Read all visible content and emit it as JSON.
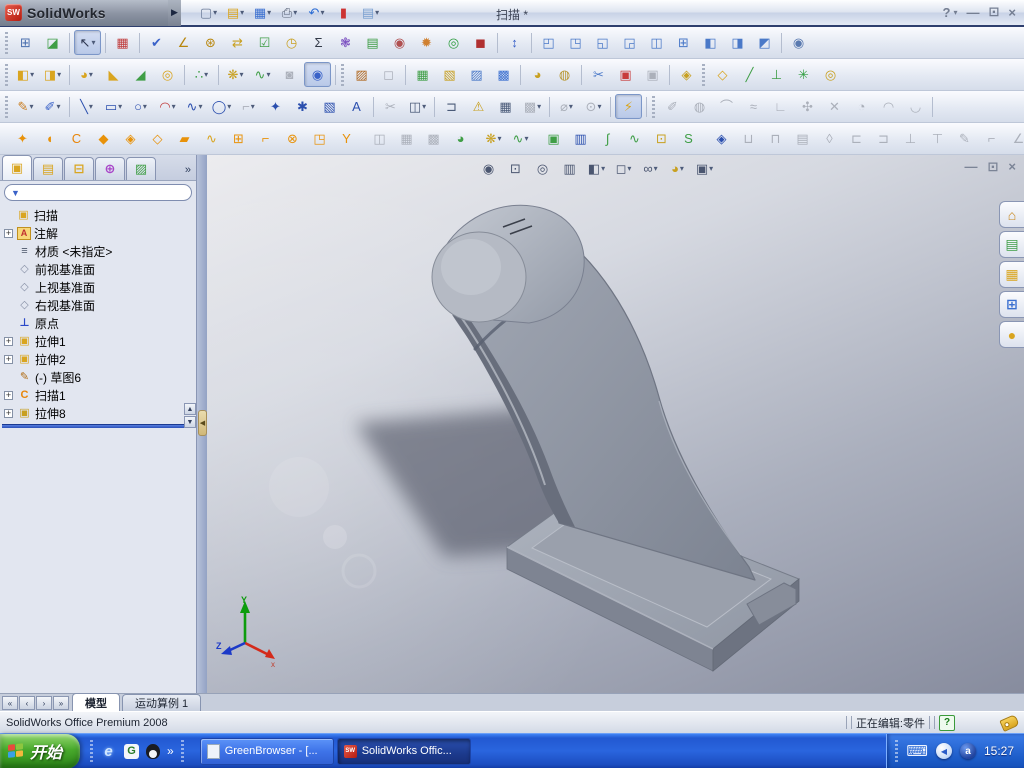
{
  "titlebar": {
    "brand": "SolidWorks",
    "logo": "SW",
    "flyout": "▶",
    "title": "扫描 *",
    "controls": {
      "help": "?",
      "dropdown": "▾",
      "minimize": "—",
      "restore": "⊡",
      "close": "×"
    }
  },
  "toolbars": {
    "standard": [
      {
        "n": "new-document",
        "g": "▢",
        "c": "#6b7b98",
        "d": 1
      },
      {
        "n": "open-document",
        "g": "▤",
        "c": "#d9a520",
        "d": 1
      },
      {
        "n": "save",
        "g": "▦",
        "c": "#3a6fd0",
        "d": 1
      },
      {
        "n": "print",
        "g": "⎙",
        "c": "#5a6478",
        "d": 1
      },
      {
        "n": "undo",
        "g": "↶",
        "c": "#2b6cd4",
        "d": 1
      },
      {
        "n": "performance",
        "g": "▮",
        "c": "#cc3333"
      },
      {
        "n": "options",
        "g": "▤",
        "c": "#7aa0d0",
        "d": 1
      }
    ],
    "row2": [
      {
        "grip": 1
      },
      {
        "n": "document-properties",
        "g": "⊞",
        "c": "#4a6fae"
      },
      {
        "n": "publish-edrawings",
        "g": "◪",
        "c": "#3f9e46"
      },
      {
        "sep": 1
      },
      {
        "n": "select",
        "g": "↖",
        "c": "#2c3650",
        "d": 1,
        "p": 1
      },
      {
        "sep": 1
      },
      {
        "n": "color-swatches",
        "g": "▦",
        "c": "#c03c3c"
      },
      {
        "sep": 1
      },
      {
        "n": "spell-checker",
        "g": "✔",
        "c": "#3a62c8"
      },
      {
        "n": "measure",
        "g": "∠",
        "c": "#b8860b"
      },
      {
        "n": "mass-properties",
        "g": "⊛",
        "c": "#b8860b"
      },
      {
        "n": "move-copy",
        "g": "⇄",
        "c": "#c8a020"
      },
      {
        "n": "design-checker",
        "g": "☑",
        "c": "#3f9e46"
      },
      {
        "n": "feature-statistics",
        "g": "◷",
        "c": "#c8a020"
      },
      {
        "n": "equations",
        "g": "Σ",
        "c": "#333a48"
      },
      {
        "n": "curvature-comb",
        "g": "❃",
        "c": "#7a4fc0"
      },
      {
        "n": "deviation-analysis",
        "g": "▤",
        "c": "#3f9e46"
      },
      {
        "n": "photoworks-preview",
        "g": "◉",
        "c": "#b05050"
      },
      {
        "n": "render-lighting",
        "g": "✹",
        "c": "#d08030"
      },
      {
        "n": "verification",
        "g": "◎",
        "c": "#2f9e3f"
      },
      {
        "n": "simulation",
        "g": "◼",
        "c": "#b03030"
      },
      {
        "sep": 1
      },
      {
        "n": "reference-dimension",
        "g": "↕",
        "c": "#3a62c8"
      },
      {
        "sep": 1
      },
      {
        "n": "view-front",
        "g": "◰",
        "c": "#4a79c8"
      },
      {
        "n": "view-back",
        "g": "◳",
        "c": "#4a79c8"
      },
      {
        "n": "view-left",
        "g": "◱",
        "c": "#4a79c8"
      },
      {
        "n": "view-right",
        "g": "◲",
        "c": "#4a79c8"
      },
      {
        "n": "view-top",
        "g": "◫",
        "c": "#4a79c8"
      },
      {
        "n": "view-bottom",
        "g": "⊞",
        "c": "#4a79c8"
      },
      {
        "n": "view-isometric",
        "g": "◧",
        "c": "#4a79c8"
      },
      {
        "n": "view-trimetric",
        "g": "◨",
        "c": "#4a79c8"
      },
      {
        "n": "view-dimetric",
        "g": "◩",
        "c": "#4a79c8"
      },
      {
        "sep": 1
      },
      {
        "n": "zoom-magnifier",
        "g": "◉",
        "c": "#5a7ab0"
      }
    ],
    "row3": [
      {
        "grip": 1
      },
      {
        "n": "view-orientation",
        "g": "◧",
        "c": "#d9a520",
        "d": 1
      },
      {
        "n": "display-mode",
        "g": "◨",
        "c": "#d9a520",
        "d": 1
      },
      {
        "sep": 1
      },
      {
        "n": "shaded-view",
        "g": "◕",
        "c": "#d9a520",
        "d": 1
      },
      {
        "n": "section-view",
        "g": "◣",
        "c": "#d9a520"
      },
      {
        "n": "section-plane",
        "g": "◢",
        "c": "#3f9e46"
      },
      {
        "n": "camera-view",
        "g": "◎",
        "c": "#d9a520"
      },
      {
        "sep": 1
      },
      {
        "n": "display-states",
        "g": "∴",
        "c": "#3f9e46",
        "d": 1
      },
      {
        "sep": 1
      },
      {
        "n": "quick-snaps",
        "g": "❋",
        "c": "#c8a020",
        "d": 1
      },
      {
        "n": "spline-tools",
        "g": "∿",
        "c": "#3f9e46",
        "d": 1
      },
      {
        "n": "align-tool",
        "g": "◙",
        "c": "#a9aeb8",
        "x": 1
      },
      {
        "n": "instant3d",
        "g": "◉",
        "c": "#3a62c8",
        "p": 1
      },
      {
        "sep": 1
      },
      {
        "grip": 1
      },
      {
        "n": "photoworks-render",
        "g": "▨",
        "c": "#b06820"
      },
      {
        "n": "render-region",
        "g": "◻",
        "c": "#a9aeb8",
        "x": 1
      },
      {
        "sep": 1
      },
      {
        "n": "render-to-file",
        "g": "▦",
        "c": "#3f9e46"
      },
      {
        "n": "render-last",
        "g": "▧",
        "c": "#c8a020"
      },
      {
        "n": "render-select",
        "g": "▨",
        "c": "#4a79c8"
      },
      {
        "n": "render-save",
        "g": "▩",
        "c": "#3a6fd0"
      },
      {
        "sep": 1
      },
      {
        "n": "scene-editor",
        "g": "◕",
        "c": "#c8a020"
      },
      {
        "n": "materials-editor",
        "g": "◍",
        "c": "#b8962e"
      },
      {
        "sep": 1
      },
      {
        "n": "copy-appearance",
        "g": "✂",
        "c": "#4a79c8"
      },
      {
        "n": "apply-appearance",
        "g": "▣",
        "c": "#c83c3c"
      },
      {
        "n": "paste-appearance",
        "g": "▣",
        "c": "#a9aeb8",
        "x": 1
      },
      {
        "sep": 1
      },
      {
        "n": "edit-scene",
        "g": "◈",
        "c": "#c8a020"
      },
      {
        "grip": 1
      },
      {
        "n": "reference-plane",
        "g": "◇",
        "c": "#d9a520"
      },
      {
        "n": "reference-axis",
        "g": "╱",
        "c": "#3f9e46"
      },
      {
        "n": "coordinate-system",
        "g": "⊥",
        "c": "#3f9e46"
      },
      {
        "n": "reference-point",
        "g": "✳",
        "c": "#2f9e3f"
      },
      {
        "n": "mate-reference",
        "g": "◎",
        "c": "#c8a020"
      }
    ],
    "row4": [
      {
        "grip": 1
      },
      {
        "n": "sketch",
        "g": "✎",
        "c": "#c87a1a",
        "d": 1
      },
      {
        "n": "3d-sketch",
        "g": "✐",
        "c": "#3a62c8",
        "d": 1
      },
      {
        "sep": 1
      },
      {
        "n": "line",
        "g": "╲",
        "c": "#2b4fae",
        "d": 1
      },
      {
        "n": "rectangle",
        "g": "▭",
        "c": "#2b4fae",
        "d": 1
      },
      {
        "n": "circle",
        "g": "○",
        "c": "#2b4fae",
        "d": 1
      },
      {
        "n": "arc",
        "g": "◠",
        "c": "#c03c3c",
        "d": 1
      },
      {
        "n": "spline",
        "g": "∿",
        "c": "#2b4fae",
        "d": 1
      },
      {
        "n": "ellipse",
        "g": "◯",
        "c": "#2b4fae",
        "d": 1
      },
      {
        "n": "sketch-fillet",
        "g": "⌐",
        "c": "#a9aeb8",
        "x": 1,
        "d": 1
      },
      {
        "n": "polygon",
        "g": "✦",
        "c": "#2b4fae"
      },
      {
        "n": "point",
        "g": "✱",
        "c": "#2b4fae"
      },
      {
        "n": "select-region",
        "g": "▧",
        "c": "#2b4fae"
      },
      {
        "n": "text",
        "g": "A",
        "c": "#2b4fae"
      },
      {
        "sep": 1
      },
      {
        "n": "trim-entities",
        "g": "✂",
        "c": "#a9aeb8",
        "x": 1
      },
      {
        "n": "convert-entities",
        "g": "◫",
        "c": "#4a5a78",
        "d": 1
      },
      {
        "sep": 1
      },
      {
        "n": "offset-entities",
        "g": "⊐",
        "c": "#4a5a78"
      },
      {
        "n": "sketch-warning",
        "g": "⚠",
        "c": "#c8a020"
      },
      {
        "n": "linear-sketch-pattern",
        "g": "▦",
        "c": "#4a5a78"
      },
      {
        "n": "circular-sketch-pattern",
        "g": "▩",
        "c": "#a9aeb8",
        "x": 1,
        "d": 1
      },
      {
        "sep": 1
      },
      {
        "n": "modify-sketch",
        "g": "⌀",
        "c": "#a9aeb8",
        "x": 1,
        "d": 1
      },
      {
        "n": "smart-dimension",
        "g": "⊙",
        "c": "#a9aeb8",
        "x": 1,
        "d": 1
      },
      {
        "sep": 1
      },
      {
        "n": "add-relations",
        "g": "⚡",
        "c": "#d9a520",
        "p": 1
      },
      {
        "sep": 1
      },
      {
        "grip": 1
      },
      {
        "n": "relation-horizontal",
        "g": "✐",
        "c": "#a9aeb8",
        "x": 1
      },
      {
        "n": "relation-vertical",
        "g": "◍",
        "c": "#a9aeb8",
        "x": 1
      },
      {
        "n": "relation-tangent",
        "g": "⌒",
        "c": "#a9aeb8",
        "x": 1
      },
      {
        "n": "relation-parallel",
        "g": "≈",
        "c": "#a9aeb8",
        "x": 1
      },
      {
        "n": "relation-perpendicular",
        "g": "∟",
        "c": "#a9aeb8",
        "x": 1
      },
      {
        "n": "relation-fix",
        "g": "✣",
        "c": "#a9aeb8",
        "x": 1
      },
      {
        "n": "relation-delete",
        "g": "✕",
        "c": "#a9aeb8",
        "x": 1
      },
      {
        "n": "relation-coincident",
        "g": "◔",
        "c": "#a9aeb8",
        "x": 1
      },
      {
        "n": "relation-concentric",
        "g": "◠",
        "c": "#a9aeb8",
        "x": 1
      },
      {
        "n": "relation-symmetric",
        "g": "◡",
        "c": "#a9aeb8",
        "x": 1
      },
      {
        "sep": 1
      }
    ],
    "row5": [
      {
        "grip": 1
      },
      {
        "n": "swept-boss",
        "g": "✦",
        "c": "#e8920a"
      },
      {
        "n": "revolved-boss",
        "g": "◖",
        "c": "#e8920a"
      },
      {
        "n": "sweep",
        "g": "C",
        "c": "#e8860a"
      },
      {
        "n": "lofted-boss",
        "g": "◆",
        "c": "#e8920a"
      },
      {
        "n": "extruded-boss",
        "g": "◈",
        "c": "#e8920a"
      },
      {
        "n": "extruded-cut",
        "g": "◇",
        "c": "#e8920a"
      },
      {
        "n": "pad",
        "g": "▰",
        "c": "#e8920a"
      },
      {
        "n": "dome",
        "g": "∿",
        "c": "#d9a520"
      },
      {
        "n": "pattern-stack",
        "g": "⊞",
        "c": "#e8920a"
      },
      {
        "n": "bend",
        "g": "⌐",
        "c": "#e8920a"
      },
      {
        "n": "cut-revolve",
        "g": "⊗",
        "c": "#e8920a"
      },
      {
        "n": "wrap",
        "g": "◳",
        "c": "#e8920a"
      },
      {
        "n": "rib",
        "g": "Y",
        "c": "#e8920a"
      },
      {
        "sep": 1
      },
      {
        "n": "mirror-feature",
        "g": "◫",
        "c": "#a9aeb8",
        "x": 1
      },
      {
        "n": "linear-pattern",
        "g": "▦",
        "c": "#a9aeb8",
        "x": 1
      },
      {
        "n": "circular-pattern",
        "g": "▩",
        "c": "#a9aeb8",
        "x": 1
      },
      {
        "n": "fillet",
        "g": "◕",
        "c": "#3f9e46"
      },
      {
        "sep": 1
      },
      {
        "n": "snap-options",
        "g": "❋",
        "c": "#c8a020",
        "d": 1
      },
      {
        "n": "flex",
        "g": "∿",
        "c": "#3f9e46",
        "d": 1
      },
      {
        "sep": 1
      },
      {
        "n": "surface-tool",
        "g": "▣",
        "c": "#3f9e46"
      },
      {
        "n": "instant-ruler",
        "g": "▥",
        "c": "#2b4fae"
      },
      {
        "n": "curve-through-points",
        "g": "∫",
        "c": "#3f9e46"
      },
      {
        "n": "projected-curve",
        "g": "∿",
        "c": "#3f9e46"
      },
      {
        "n": "composite-curve",
        "g": "⊡",
        "c": "#c8a020"
      },
      {
        "n": "helix-spiral",
        "g": "S",
        "c": "#3f9e46"
      },
      {
        "sep": 1
      },
      {
        "n": "sheet-metal-tag",
        "g": "◈",
        "c": "#2b4fae"
      },
      {
        "n": "base-flange",
        "g": "⊔",
        "c": "#a9aeb8",
        "x": 1
      },
      {
        "n": "edge-flange",
        "g": "⊓",
        "c": "#a9aeb8",
        "x": 1
      },
      {
        "n": "miter-flange",
        "g": "▤",
        "c": "#a9aeb8",
        "x": 1
      },
      {
        "n": "sketched-bend",
        "g": "◊",
        "c": "#a9aeb8",
        "x": 1
      },
      {
        "n": "closed-corner",
        "g": "⊏",
        "c": "#a9aeb8",
        "x": 1
      },
      {
        "n": "jog",
        "g": "⊐",
        "c": "#a9aeb8",
        "x": 1
      },
      {
        "n": "hem",
        "g": "⊥",
        "c": "#a9aeb8",
        "x": 1
      },
      {
        "n": "unfold",
        "g": "⊤",
        "c": "#a9aeb8",
        "x": 1
      },
      {
        "n": "fold",
        "g": "✎",
        "c": "#a9aeb8",
        "x": 1
      },
      {
        "n": "flatten",
        "g": "⌐",
        "c": "#a9aeb8",
        "x": 1
      },
      {
        "n": "corner-relief",
        "g": "∠",
        "c": "#a9aeb8",
        "x": 1
      },
      {
        "sep": 1
      }
    ],
    "hud": [
      {
        "n": "zoom-to-fit",
        "g": "◉",
        "c": "#4b5670"
      },
      {
        "n": "zoom-to-area",
        "g": "⊡",
        "c": "#4b5670"
      },
      {
        "n": "zoom-previous",
        "g": "◎",
        "c": "#4b5670"
      },
      {
        "n": "section-view-hud",
        "g": "▥",
        "c": "#4b5670"
      },
      {
        "n": "view-orientation-hud",
        "g": "◧",
        "c": "#4b5670",
        "d": 1
      },
      {
        "n": "display-style-hud",
        "g": "◻",
        "c": "#4b5670",
        "d": 1
      },
      {
        "n": "hide-show-items",
        "g": "∞",
        "c": "#4b5670",
        "d": 1
      },
      {
        "n": "edit-appearance-hud",
        "g": "◕",
        "c": "#c8a020",
        "d": 1
      },
      {
        "n": "apply-scene-hud",
        "g": "▣",
        "c": "#4b5670",
        "d": 1
      }
    ],
    "taskpane": [
      {
        "n": "solidworks-resources",
        "g": "⌂",
        "c": "#c8861a"
      },
      {
        "n": "design-library",
        "g": "▤",
        "c": "#3f9e46"
      },
      {
        "n": "file-explorer",
        "g": "▦",
        "c": "#d9a520"
      },
      {
        "n": "view-palette",
        "g": "⊞",
        "c": "#3a6fd0"
      },
      {
        "n": "appearances-scenes",
        "g": "●",
        "c": "#d9a520"
      }
    ]
  },
  "panel": {
    "tabs": [
      {
        "name": "features",
        "active": true
      },
      {
        "name": "properties"
      },
      {
        "name": "configurations"
      },
      {
        "name": "dimxpert"
      },
      {
        "name": "appearances"
      }
    ],
    "tabs_more": "»",
    "tree_root": "扫描",
    "tree": [
      {
        "label": "注解",
        "icon": "annotations",
        "plus": true
      },
      {
        "label": "材质 <未指定>",
        "icon": "material"
      },
      {
        "label": "前视基准面",
        "icon": "plane"
      },
      {
        "label": "上视基准面",
        "icon": "plane"
      },
      {
        "label": "右视基准面",
        "icon": "plane"
      },
      {
        "label": "原点",
        "icon": "origin"
      },
      {
        "label": "拉伸1",
        "icon": "extrude",
        "plus": true
      },
      {
        "label": "拉伸2",
        "icon": "extrude",
        "plus": true
      },
      {
        "label": "(-) 草图6",
        "icon": "sketch"
      },
      {
        "label": "扫描1",
        "icon": "sweep",
        "plus": true
      },
      {
        "label": "拉伸8",
        "icon": "extrude8",
        "plus": true
      }
    ]
  },
  "doc_controls": {
    "minimize": "—",
    "restore": "⊡",
    "close": "×"
  },
  "bottom": {
    "nav": [
      "«",
      "‹",
      "›",
      "»"
    ],
    "tabs": [
      {
        "label": "模型",
        "active": true
      },
      {
        "label": "运动算例 1",
        "active": false
      }
    ]
  },
  "statusbar": {
    "left": "SolidWorks Office Premium 2008",
    "editing": "正在编辑:零件",
    "help_badge": "?"
  },
  "taskbar": {
    "start": "开始",
    "quick": {
      "ie": "e",
      "greenbrowser": "G",
      "more": "»"
    },
    "tasks": [
      {
        "label": "GreenBrowser - [...",
        "active": false
      },
      {
        "label": "SolidWorks Offic...",
        "active": true
      }
    ],
    "tray": {
      "keyboard": "⌨",
      "chevron": "◀",
      "ime": "a",
      "time": "15:27"
    }
  },
  "triad": {
    "x": "x",
    "y": "Y",
    "z": "Z"
  },
  "colors": {
    "taskbar_blue": "#2a65de",
    "start_green": "#48a92c",
    "title_silver": "#dee4f0",
    "viewport_top": "#ececef",
    "viewport_bottom": "#878c9e",
    "model_gray": "#9aa0ad",
    "rollback_blue": "#2b50b8",
    "sw_red": "#b51c10"
  }
}
